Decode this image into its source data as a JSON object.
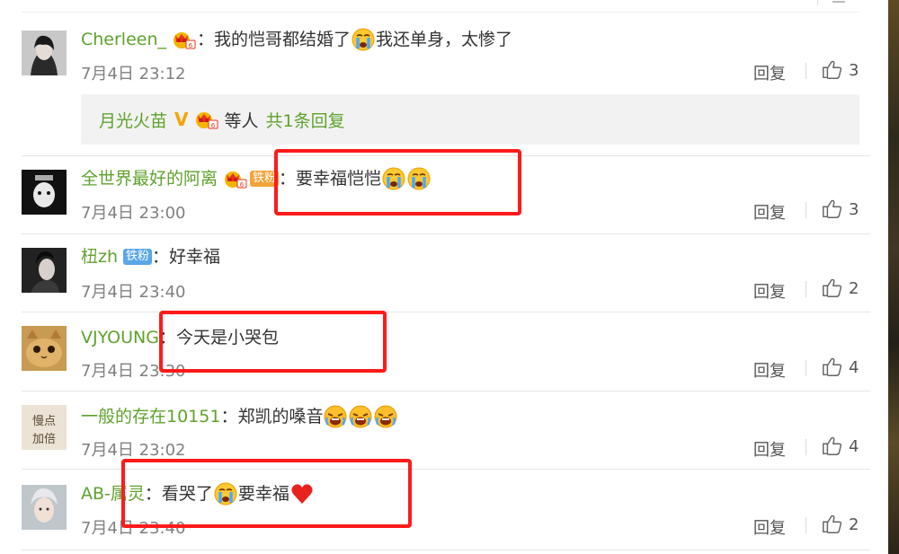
{
  "reply_label": "回复",
  "colon": "：",
  "comments": [
    {
      "username": "Cherleen_",
      "text_before": "我的恺哥都结婚了",
      "text_after": "我还单身，太惨了",
      "time": "7月4日 23:12",
      "likes": "3",
      "subreply": {
        "username": "月光火苗",
        "v_mark": "V",
        "deng": "等人",
        "total": "共1条回复"
      }
    },
    {
      "username": "全世界最好的阿离",
      "fan_badge": "铁粉",
      "text": "要幸福恺恺",
      "time": "7月4日 23:00",
      "likes": "3"
    },
    {
      "username": "杻zh",
      "fan_badge": "铁粉",
      "text": "好幸福",
      "time": "7月4日 23:40",
      "likes": "2"
    },
    {
      "username": "VJYOUNG",
      "text": "今天是小哭包",
      "time": "7月4日 23:30",
      "likes": "4"
    },
    {
      "username": "一般的存在10151",
      "text": "郑凯的嗓音",
      "time": "7月4日 23:02",
      "likes": "4"
    },
    {
      "username": "AB-属灵",
      "text_before": "看哭了",
      "text_after": "要幸福",
      "time": "7月4日 23:40",
      "likes": "2"
    }
  ],
  "avatar_text": "慢点\n加倍",
  "colors": {
    "username": "#5fa22d",
    "text": "#333333",
    "meta": "#808080",
    "highlight_box": "#ff1a1a",
    "subreply_bg": "#f2f2f2"
  },
  "icons": [
    "crying-emoji",
    "sobbing-emoji",
    "red-heart-emoji",
    "thumbs-up-icon",
    "vip-crown-badge"
  ]
}
